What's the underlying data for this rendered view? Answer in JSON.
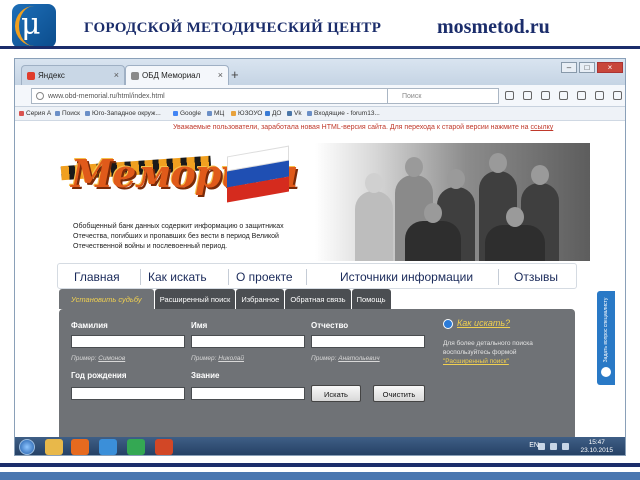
{
  "slide": {
    "org_title": "ГОРОДСКОЙ МЕТОДИЧЕСКИЙ ЦЕНТР",
    "site": "mosmetod.ru",
    "logo_letter": "μ"
  },
  "browser": {
    "tabs": [
      {
        "label": "Яндекс",
        "active": false,
        "favicon_color": "#e03c2c"
      },
      {
        "label": "ОБД Мемориал",
        "active": true,
        "favicon_color": "#8a8a8a"
      }
    ],
    "new_tab": "+",
    "url": "www.obd-memorial.ru/html/index.html",
    "search_placeholder": "Поиск",
    "bookmarks": [
      {
        "label": "Серия А",
        "color": "#d9534f"
      },
      {
        "label": "Поиск",
        "color": "#6b8fc7"
      },
      {
        "label": "Юго-Западное окруж...",
        "color": "#6b8fc7"
      },
      {
        "label": "Google",
        "color": "#4285f4"
      },
      {
        "label": "МЦ",
        "color": "#6b8fc7"
      },
      {
        "label": "ЮЗОУО",
        "color": "#e8a23c"
      },
      {
        "label": "ДО",
        "color": "#3a7bd5"
      },
      {
        "label": "Vk",
        "color": "#4a76a8"
      },
      {
        "label": "Входящие - forum13...",
        "color": "#6b8fc7"
      }
    ]
  },
  "page": {
    "notice_text": "Уважаемые пользователи, заработала новая HTML-версия сайта. Для перехода к старой версии нажмите на",
    "notice_link": "ссылку",
    "site_title": "Мемориал",
    "flag_colors": [
      "#ffffff",
      "#1f4fb3",
      "#d52b1e"
    ],
    "description": "Обобщенный банк данных содержит информацию о защитниках Отечества, погибших и пропавших без вести в период Великой Отечественной войны и послевоенный период.",
    "nav": [
      "Главная",
      "Как искать",
      "О проекте",
      "Источники информации",
      "Отзывы"
    ],
    "search_tabs": [
      "Установить судьбу",
      "Расширенный поиск",
      "Избранное",
      "Обратная связь",
      "Помощь"
    ],
    "fields": {
      "surname": {
        "label": "Фамилия",
        "example_prefix": "Пример:",
        "example": "Симонов"
      },
      "name": {
        "label": "Имя",
        "example_prefix": "Пример:",
        "example": "Николай"
      },
      "patronymic": {
        "label": "Отчество",
        "example_prefix": "Пример:",
        "example": "Анатольевич"
      },
      "birth_year": {
        "label": "Год рождения"
      },
      "rank": {
        "label": "Звание"
      }
    },
    "buttons": {
      "search": "Искать",
      "clear": "Очистить"
    },
    "help": {
      "title": "Как искать?",
      "text": "Для более детального поиска воспользуйтесь формой",
      "link": "\"Расширенный поиск\""
    },
    "side_widget": "Задать вопрос специалисту"
  },
  "taskbar": {
    "apps": [
      {
        "name": "folder-app",
        "color": "#e8b84a"
      },
      {
        "name": "firefox-app",
        "color": "#e66a1f"
      },
      {
        "name": "ie-app",
        "color": "#3b8fd9"
      },
      {
        "name": "chrome-app",
        "color": "#34a853"
      },
      {
        "name": "powerpoint-app",
        "color": "#d24726"
      }
    ],
    "lang": "EN",
    "time": "15:47",
    "date": "23.10.2015"
  }
}
